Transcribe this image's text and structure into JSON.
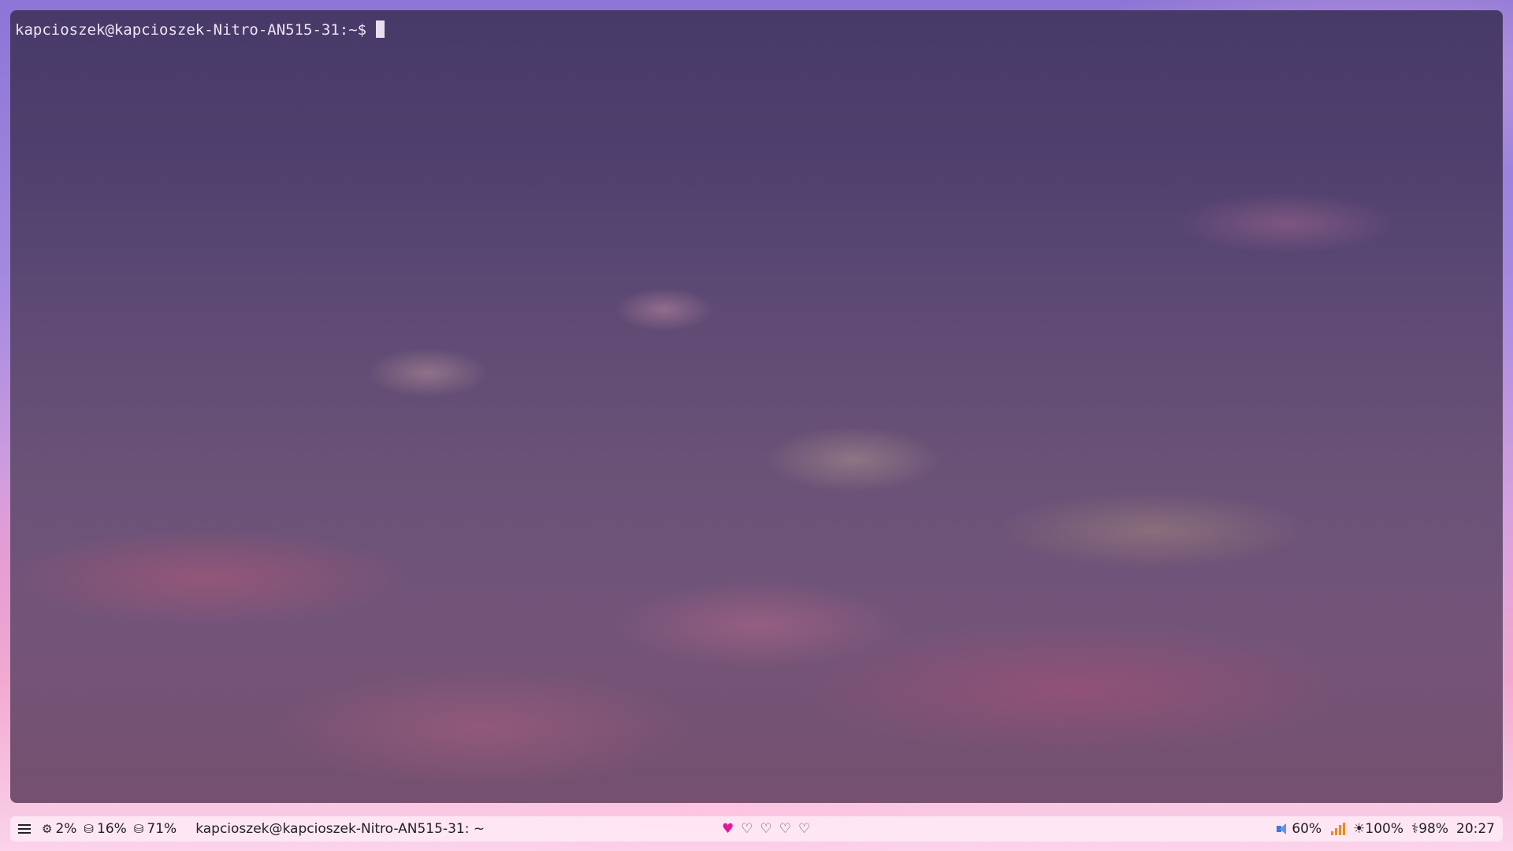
{
  "terminal": {
    "prompt": "kapcioszek@kapcioszek-Nitro-AN515-31:~$"
  },
  "statusbar": {
    "stats": [
      {
        "icon": "cpu-icon",
        "glyph": "⚙",
        "value": "2%"
      },
      {
        "icon": "database-icon",
        "glyph": "⛁",
        "value": "16%"
      },
      {
        "icon": "database-icon",
        "glyph": "⛁",
        "value": "71%"
      }
    ],
    "window_title": "kapcioszek@kapcioszek-Nitro-AN515-31: ~",
    "workspaces": [
      {
        "glyph": "♥",
        "active": true
      },
      {
        "glyph": "♡",
        "active": false
      },
      {
        "glyph": "♡",
        "active": false
      },
      {
        "glyph": "♡",
        "active": false
      },
      {
        "glyph": "♡",
        "active": false
      }
    ],
    "volume": "60%",
    "brightness_glyph": "☀",
    "brightness": "100%",
    "battery_glyph": "⚕",
    "battery": "98%",
    "clock": "20:27"
  },
  "colors": {
    "active_workspace": "#e0189a",
    "wifi": "#f08a15",
    "volume": "#3d7bd6"
  }
}
